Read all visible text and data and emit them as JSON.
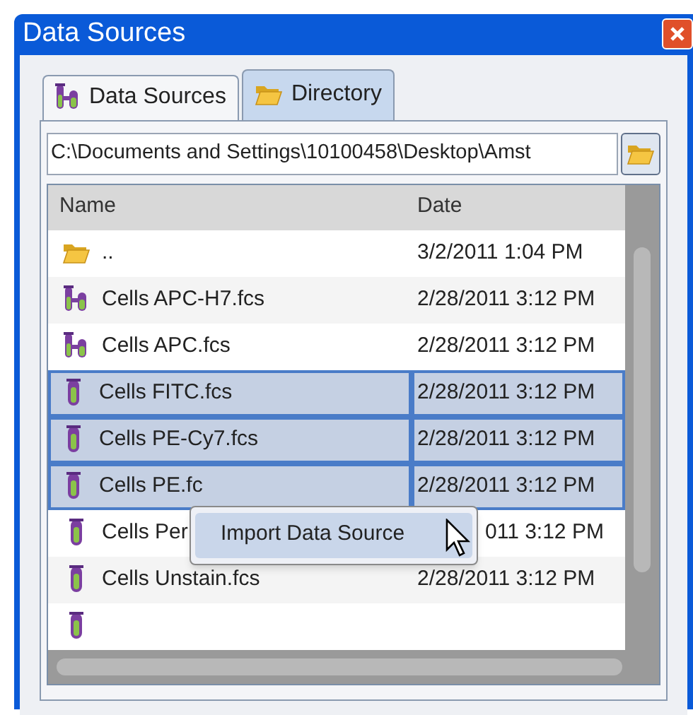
{
  "window": {
    "title": "Data Sources"
  },
  "tabs": [
    {
      "label": "Data Sources",
      "kind": "tube",
      "selected": false
    },
    {
      "label": "Directory",
      "kind": "folder",
      "selected": true
    }
  ],
  "path_field": {
    "value": "C:\\Documents and Settings\\10100458\\Desktop\\Amst"
  },
  "table": {
    "columns": [
      "Name",
      "Date"
    ],
    "rows": [
      {
        "kind": "folder",
        "name": "..",
        "date": "3/2/2011 1:04 PM",
        "selected": false
      },
      {
        "kind": "tubes",
        "name": "Cells APC-H7.fcs",
        "date": "2/28/2011 3:12 PM",
        "selected": false
      },
      {
        "kind": "tubes",
        "name": "Cells APC.fcs",
        "date": "2/28/2011 3:12 PM",
        "selected": false
      },
      {
        "kind": "tube",
        "name": "Cells FITC.fcs",
        "date": "2/28/2011 3:12 PM",
        "selected": true
      },
      {
        "kind": "tube",
        "name": "Cells PE-Cy7.fcs",
        "date": "2/28/2011 3:12 PM",
        "selected": true
      },
      {
        "kind": "tube",
        "name": "Cells PE.fc",
        "date": "2/28/2011 3:12 PM",
        "selected": true
      },
      {
        "kind": "tube",
        "name": "Cells Per",
        "date": "011 3:12 PM",
        "selected": false
      },
      {
        "kind": "tube",
        "name": "Cells Unstain.fcs",
        "date": "2/28/2011 3:12 PM",
        "selected": false
      },
      {
        "kind": "tube",
        "selected": false
      }
    ]
  },
  "context_menu": {
    "items": [
      "Import Data Source"
    ]
  }
}
